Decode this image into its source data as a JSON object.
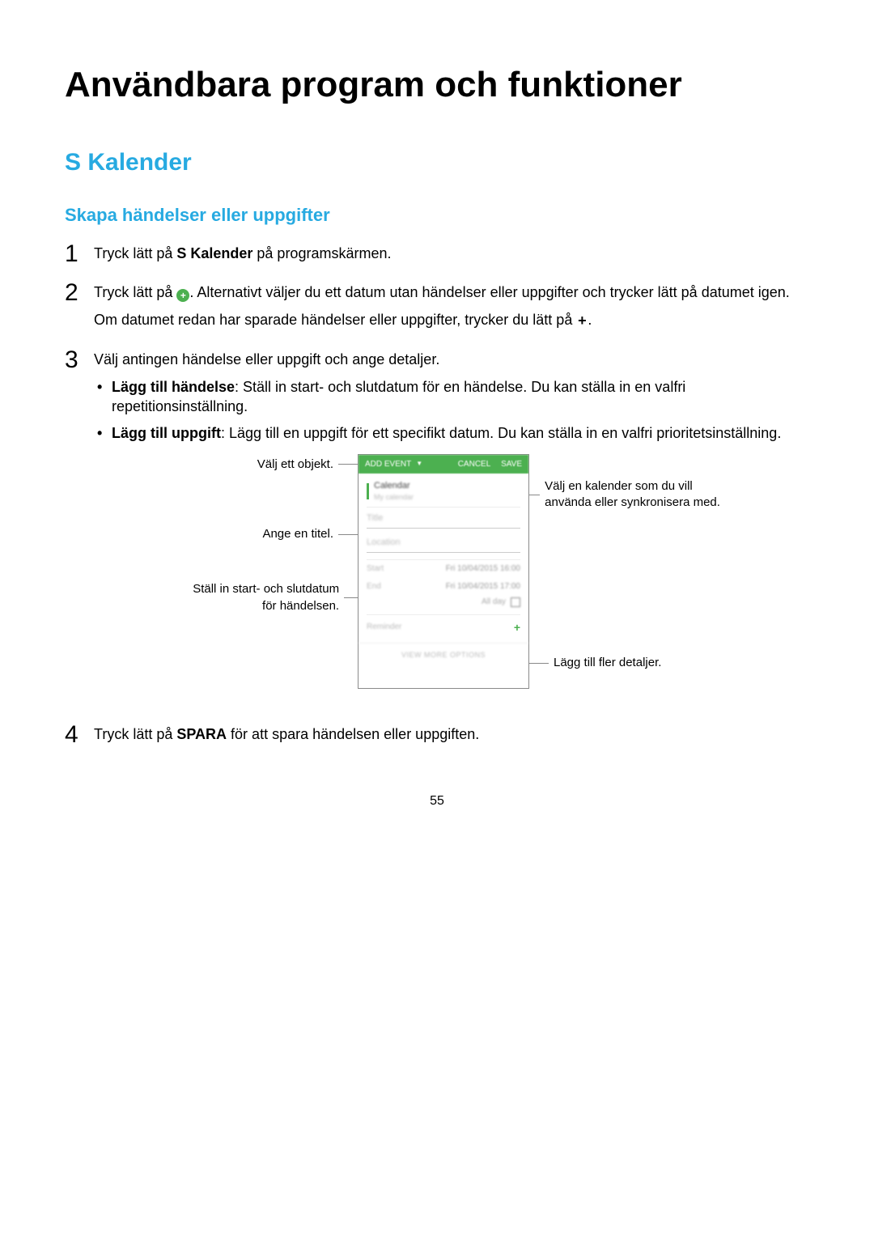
{
  "page": {
    "title": "Användbara program och funktioner",
    "section_h2": "S Kalender",
    "section_h3": "Skapa händelser eller uppgifter",
    "page_number": "55"
  },
  "steps": {
    "s1": {
      "num": "1",
      "text_a": "Tryck lätt på ",
      "text_b_bold": "S Kalender",
      "text_c": " på programskärmen."
    },
    "s2": {
      "num": "2",
      "p1_a": "Tryck lätt på ",
      "p1_b": ". Alternativt väljer du ett datum utan händelser eller uppgifter och trycker lätt på datumet igen.",
      "p2_a": "Om datumet redan har sparade händelser eller uppgifter, trycker du lätt på ",
      "p2_b": "."
    },
    "s3": {
      "num": "3",
      "intro": "Välj antingen händelse eller uppgift och ange detaljer.",
      "b1_bold": "Lägg till händelse",
      "b1_rest": ": Ställ in start- och slutdatum för en händelse. Du kan ställa in en valfri repetitionsinställning.",
      "b2_bold": "Lägg till uppgift",
      "b2_rest": ": Lägg till en uppgift för ett specifikt datum. Du kan ställa in en valfri prioritetsinställning."
    },
    "s4": {
      "num": "4",
      "text_a": "Tryck lätt på ",
      "text_b_bold": "SPARA",
      "text_c": " för att spara händelsen eller uppgiften."
    }
  },
  "callouts": {
    "left1": "Välj ett objekt.",
    "left2": "Ange en titel.",
    "left3": "Ställ in start- och slutdatum för händelsen.",
    "right1": "Välj en kalender som du vill använda eller synkronisera med.",
    "right2": "Lägg till fler detaljer."
  },
  "phone": {
    "topbar_left": "Add event",
    "topbar_cancel": "CANCEL",
    "topbar_save": "SAVE",
    "cal_name": "Calendar",
    "cal_sub": "My calendar",
    "title_ph": "Title",
    "location_ph": "Location",
    "start_lbl": "Start",
    "start_val": "Fri 10/04/2015  16:00",
    "end_lbl": "End",
    "end_val": "Fri 10/04/2015  17:00",
    "allday": "All day",
    "reminder": "Reminder",
    "viewmore": "VIEW MORE OPTIONS"
  }
}
